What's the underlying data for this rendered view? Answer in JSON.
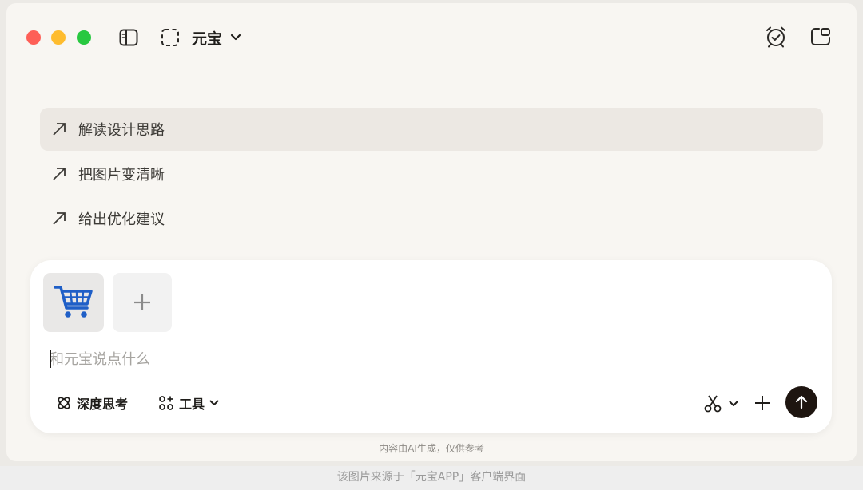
{
  "titlebar": {
    "model_name": "元宝",
    "icons": [
      "sidebar-toggle-icon",
      "select-region-icon",
      "chevron-down-icon",
      "alarm-clock-icon",
      "new-window-icon"
    ]
  },
  "suggestions": [
    {
      "label": "解读设计思路",
      "icon": "arrow-up-right-icon"
    },
    {
      "label": "把图片变清晰",
      "icon": "arrow-up-right-icon"
    },
    {
      "label": "给出优化建议",
      "icon": "arrow-up-right-icon"
    }
  ],
  "composer": {
    "attachment_icon": "shopping-cart-icon",
    "add_attachment_icon": "plus-icon",
    "placeholder": "和元宝说点什么",
    "deep_think_label": "深度思考",
    "tools_label": "工具",
    "accent": "#1e1510"
  },
  "disclaimer": "内容由AI生成，仅供参考",
  "footer": "该图片来源于「元宝APP」客户端界面"
}
